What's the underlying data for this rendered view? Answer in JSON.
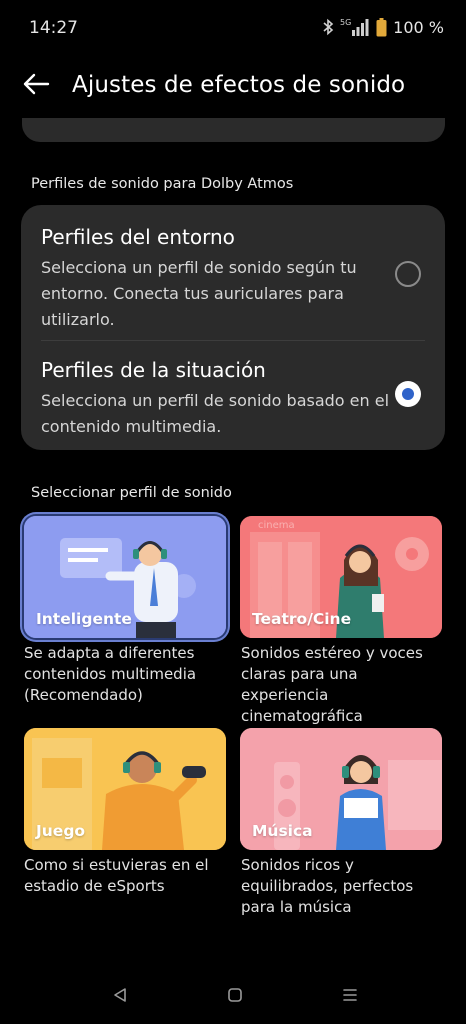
{
  "status": {
    "time": "14:27",
    "network": "5G",
    "battery": "100 %"
  },
  "header": {
    "title": "Ajustes de efectos de sonido"
  },
  "dolby": {
    "section_label": "Perfiles de sonido para Dolby Atmos",
    "options": [
      {
        "title": "Perfiles del entorno",
        "description": "Selecciona un perfil de sonido según tu entorno. Conecta tus auriculares para utilizarlo.",
        "selected": false
      },
      {
        "title": "Perfiles de la situación",
        "description": "Selecciona un perfil de sonido basado en el contenido multimedia.",
        "selected": true
      }
    ]
  },
  "profiles": {
    "section_label": "Seleccionar perfil de sonido",
    "items": [
      {
        "label": "Inteligente",
        "description": "Se adapta a diferentes contenidos multimedia (Recomendado)",
        "selected": true
      },
      {
        "label": "Teatro/Cine",
        "description": "Sonidos estéreo y voces claras para una experiencia cinematográfica",
        "selected": false
      },
      {
        "label": "Juego",
        "description": "Como si estuvieras en el estadio de eSports",
        "selected": false
      },
      {
        "label": "Música",
        "description": "Sonidos ricos y equilibrados, perfectos para la música",
        "selected": false
      }
    ]
  },
  "tile_art": {
    "cinema_sign": "cinema"
  },
  "colors": {
    "background": "#000000",
    "card": "#2b2b2b",
    "radio_selected": "#2f63c9",
    "intelligent_tile": "#8f9ef0",
    "cinema_tile": "#f26d6f",
    "game_tile": "#f8c04f",
    "music_tile": "#f4a0aa"
  }
}
